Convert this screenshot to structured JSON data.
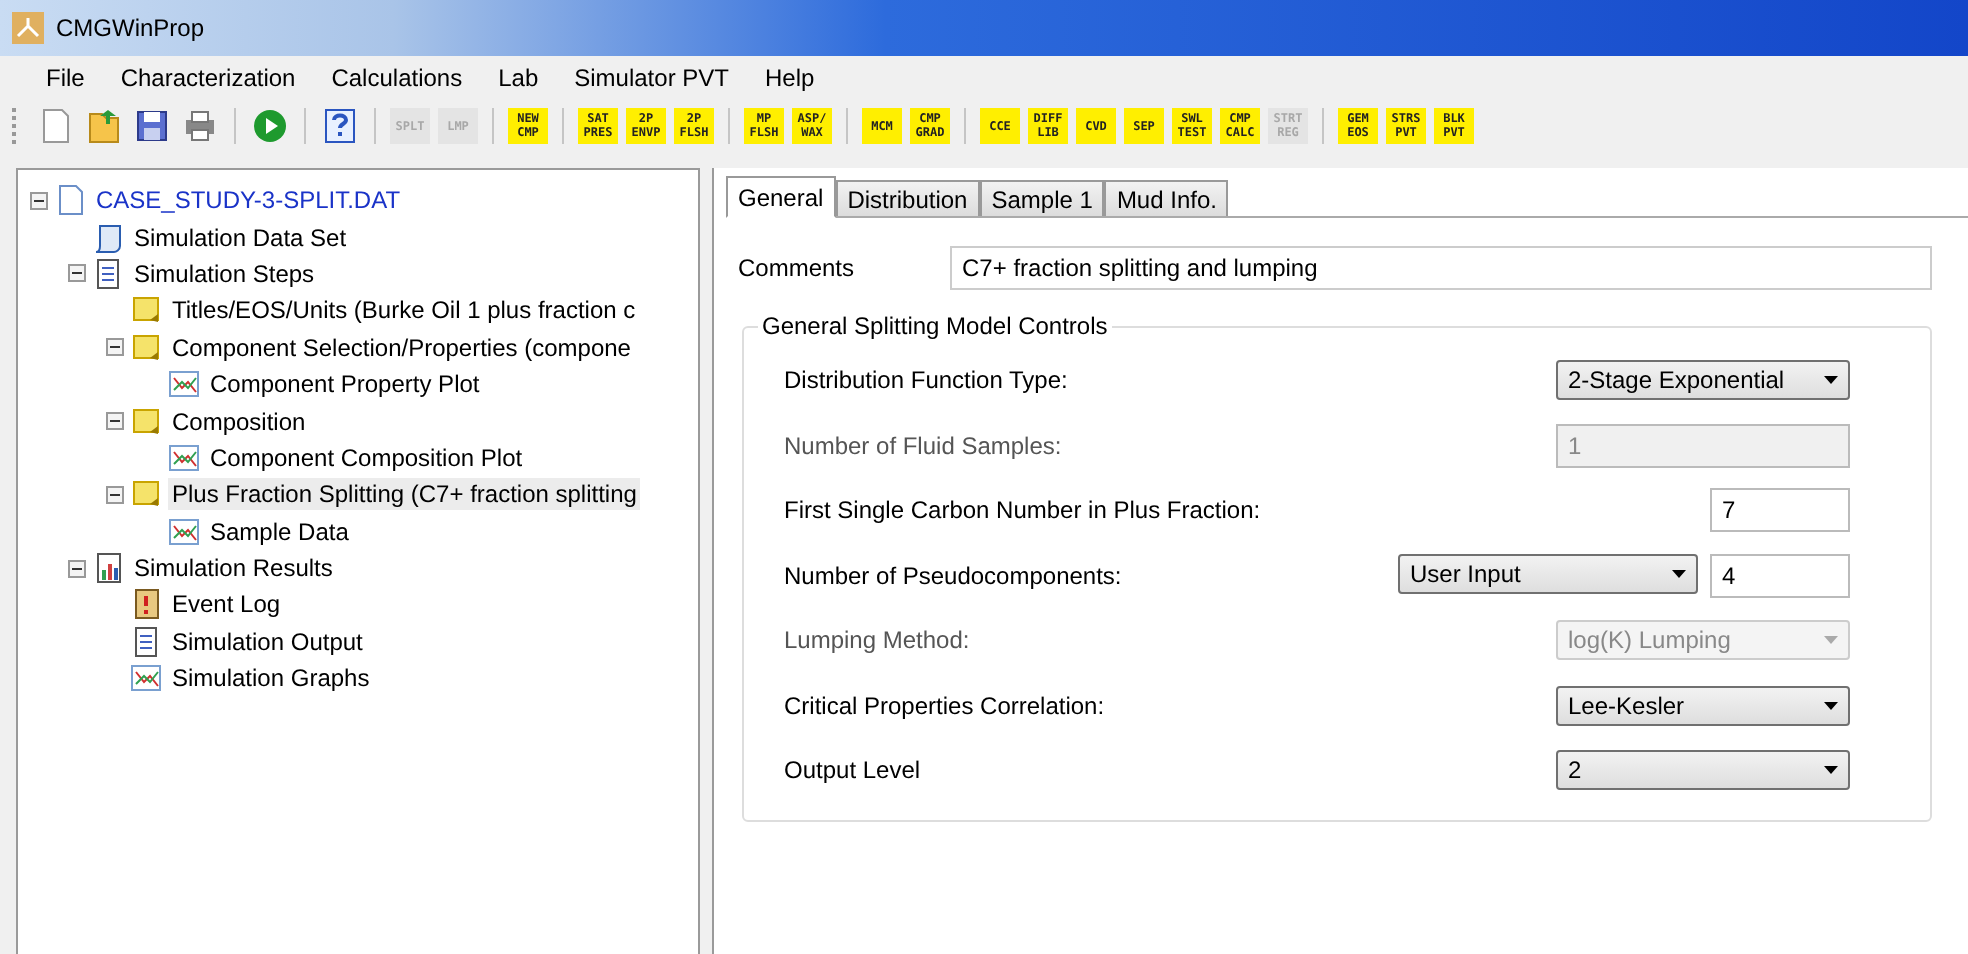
{
  "window": {
    "title": "CMGWinProp"
  },
  "menu": [
    "File",
    "Characterization",
    "Calculations",
    "Lab",
    "Simulator PVT",
    "Help"
  ],
  "toolbar": [
    {
      "kind": "new"
    },
    {
      "kind": "open"
    },
    {
      "kind": "save"
    },
    {
      "kind": "print"
    },
    {
      "kind": "separator"
    },
    {
      "kind": "run"
    },
    {
      "kind": "separator"
    },
    {
      "kind": "help"
    },
    {
      "kind": "separator"
    },
    {
      "kind": "tool",
      "lines": [
        "SPLT"
      ],
      "enabled": false
    },
    {
      "kind": "tool",
      "lines": [
        "LMP"
      ],
      "enabled": false
    },
    {
      "kind": "separator"
    },
    {
      "kind": "tool",
      "lines": [
        "NEW",
        "CMP"
      ],
      "enabled": true
    },
    {
      "kind": "separator"
    },
    {
      "kind": "tool",
      "lines": [
        "SAT",
        "PRES"
      ],
      "enabled": true
    },
    {
      "kind": "tool",
      "lines": [
        "2P",
        "ENVP"
      ],
      "enabled": true
    },
    {
      "kind": "tool",
      "lines": [
        "2P",
        "FLSH"
      ],
      "enabled": true
    },
    {
      "kind": "separator"
    },
    {
      "kind": "tool",
      "lines": [
        "MP",
        "FLSH"
      ],
      "enabled": true
    },
    {
      "kind": "tool",
      "lines": [
        "ASP/",
        "WAX"
      ],
      "enabled": true
    },
    {
      "kind": "separator"
    },
    {
      "kind": "tool",
      "lines": [
        "MCM"
      ],
      "enabled": true
    },
    {
      "kind": "tool",
      "lines": [
        "CMP",
        "GRAD"
      ],
      "enabled": true
    },
    {
      "kind": "separator"
    },
    {
      "kind": "tool",
      "lines": [
        "CCE"
      ],
      "enabled": true
    },
    {
      "kind": "tool",
      "lines": [
        "DIFF",
        "LIB"
      ],
      "enabled": true
    },
    {
      "kind": "tool",
      "lines": [
        "CVD"
      ],
      "enabled": true
    },
    {
      "kind": "tool",
      "lines": [
        "SEP"
      ],
      "enabled": true
    },
    {
      "kind": "tool",
      "lines": [
        "SWL",
        "TEST"
      ],
      "enabled": true
    },
    {
      "kind": "tool",
      "lines": [
        "CMP",
        "CALC"
      ],
      "enabled": true
    },
    {
      "kind": "tool",
      "lines": [
        "STRT",
        "REG"
      ],
      "enabled": false
    },
    {
      "kind": "separator"
    },
    {
      "kind": "tool",
      "lines": [
        "GEM",
        "EOS"
      ],
      "enabled": true
    },
    {
      "kind": "tool",
      "lines": [
        "STRS",
        "PVT"
      ],
      "enabled": true
    },
    {
      "kind": "tool",
      "lines": [
        "BLK",
        "PVT"
      ],
      "enabled": true
    }
  ],
  "tree": [
    {
      "label": "CASE_STUDY-3-SPLIT.DAT",
      "kind": "file",
      "expanded": true,
      "selected": false,
      "children": [
        {
          "label": "Simulation Data Set",
          "kind": "script",
          "selected": false
        },
        {
          "label": "Simulation Steps",
          "kind": "doc",
          "expanded": true,
          "selected": false,
          "children": [
            {
              "label": "Titles/EOS/Units (Burke Oil 1 plus fraction c",
              "kind": "step",
              "selected": false
            },
            {
              "label": "Component Selection/Properties (compone",
              "kind": "step",
              "expanded": true,
              "selected": false,
              "children": [
                {
                  "label": "Component Property Plot",
                  "kind": "plot",
                  "selected": false
                }
              ]
            },
            {
              "label": "Composition",
              "kind": "step",
              "expanded": true,
              "selected": false,
              "children": [
                {
                  "label": "Component Composition Plot",
                  "kind": "plot",
                  "selected": false
                }
              ]
            },
            {
              "label": "Plus Fraction Splitting (C7+ fraction splitting",
              "kind": "step",
              "expanded": true,
              "selected": true,
              "children": [
                {
                  "label": "Sample Data",
                  "kind": "plot",
                  "selected": false
                }
              ]
            }
          ]
        },
        {
          "label": "Simulation Results",
          "kind": "results",
          "expanded": true,
          "selected": false,
          "children": [
            {
              "label": "Event Log",
              "kind": "log",
              "selected": false
            },
            {
              "label": "Simulation Output",
              "kind": "doc",
              "selected": false
            },
            {
              "label": "Simulation Graphs",
              "kind": "plot",
              "selected": false
            }
          ]
        }
      ]
    }
  ],
  "tabs": [
    {
      "label": "General",
      "selected": true
    },
    {
      "label": "Distribution",
      "selected": false
    },
    {
      "label": "Sample 1",
      "selected": false
    },
    {
      "label": "Mud Info.",
      "selected": false
    }
  ],
  "comments": {
    "label": "Comments",
    "value": "C7+ fraction splitting and lumping"
  },
  "group": {
    "title": "General Splitting Model Controls",
    "rows": [
      {
        "label": "Distribution Function Type:",
        "controls": [
          {
            "kind": "dropdown",
            "value": "2-Stage Exponential",
            "disabled": false
          }
        ]
      },
      {
        "label": "Number of Fluid Samples:",
        "controls": [
          {
            "kind": "text",
            "value": "1",
            "disabled": true
          }
        ]
      },
      {
        "label": "First Single Carbon Number in Plus Fraction:",
        "controls": [
          {
            "kind": "number",
            "value": "7",
            "disabled": false
          }
        ]
      },
      {
        "label": "Number of Pseudocomponents:",
        "controls": [
          {
            "kind": "select",
            "value": "User Input",
            "disabled": false
          },
          {
            "kind": "number",
            "value": "4",
            "disabled": false
          }
        ]
      },
      {
        "label": "Lumping Method:",
        "controls": [
          {
            "kind": "dropdown",
            "value": "log(K) Lumping",
            "disabled": true
          }
        ]
      },
      {
        "label": "Critical Properties Correlation:",
        "controls": [
          {
            "kind": "dropdown",
            "value": "Lee-Kesler",
            "disabled": false
          }
        ]
      },
      {
        "label": "Output Level",
        "controls": [
          {
            "kind": "dropdown",
            "value": "2",
            "disabled": false
          }
        ]
      }
    ]
  }
}
